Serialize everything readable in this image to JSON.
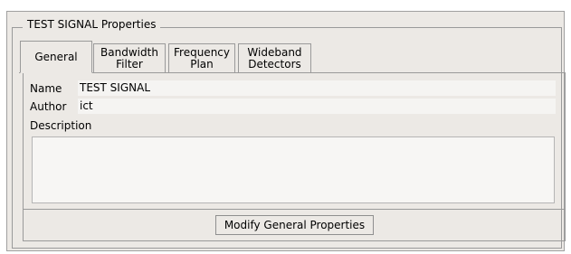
{
  "group_title": "TEST SIGNAL Properties",
  "tabs": [
    {
      "label_line1": "General",
      "label_line2": ""
    },
    {
      "label_line1": "Bandwidth",
      "label_line2": "Filter"
    },
    {
      "label_line1": "Frequency",
      "label_line2": "Plan"
    },
    {
      "label_line1": "Wideband",
      "label_line2": "Detectors"
    }
  ],
  "fields": {
    "name_label": "Name",
    "name_value": "TEST SIGNAL",
    "author_label": "Author",
    "author_value": "ict",
    "description_label": "Description",
    "description_value": ""
  },
  "modify_button_label": "Modify General Properties"
}
